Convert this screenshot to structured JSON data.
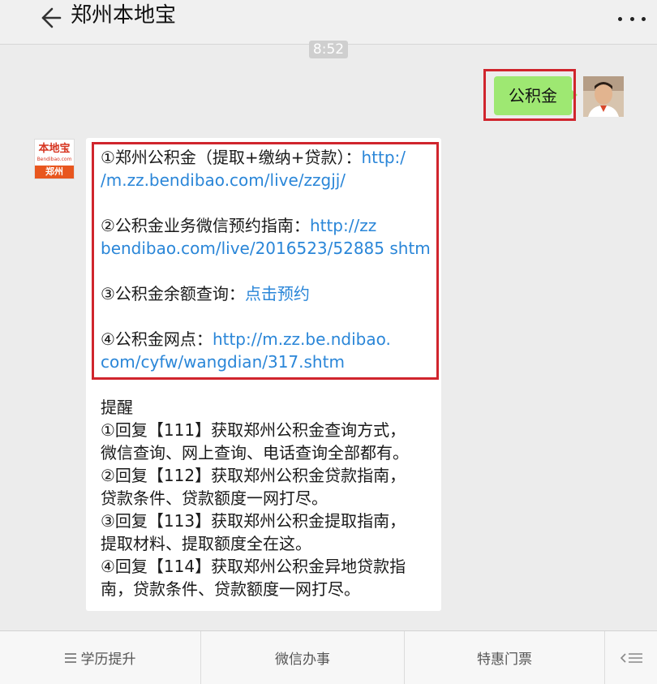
{
  "header": {
    "title": "郑州本地宝",
    "back_icon": "arrow-left-icon",
    "more_icon": "more-dots-icon"
  },
  "time_badge": "8:52",
  "sent_message": {
    "text": "公积金"
  },
  "bot": {
    "logo_text": "本地宝",
    "logo_sub": "Bendibao.com",
    "logo_city": "郑州"
  },
  "reply": {
    "item1_label": "①郑州公积金（提取+缴纳+贷款）：",
    "item1_link_a": "http:/",
    "item1_link_b": "/m.zz.bendibao.com/live/zzgjj/",
    "item2_label": "②公积金业务微信预约指南：",
    "item2_link_a": "http://zz",
    "item2_link_b": "bendibao.com/live/2016523/52885 shtm",
    "item3_label": "③公积金余额查询：",
    "item3_link": "点击预约",
    "item4_label": "④公积金网点：",
    "item4_link_a": "http://m.zz.be.ndibao.",
    "item4_link_b": "com/cyfw/wangdian/317.shtm",
    "reminder_title": "提醒",
    "reminder_lines": [
      "①回复【111】获取郑州公积金查询方式，",
      "微信查询、网上查询、电话查询全部都有。",
      "②回复【112】获取郑州公积金贷款指南，",
      "贷款条件、贷款额度一网打尽。",
      "③回复【113】获取郑州公积金提取指南，",
      "提取材料、提取额度全在这。",
      "④回复【114】获取郑州公积金异地贷款指",
      "南，贷款条件、贷款额度一网打尽。"
    ]
  },
  "bottom_menu": {
    "items": [
      "学历提升",
      "微信办事",
      "特惠门票"
    ],
    "menu_icon": "hamburger-icon",
    "keyboard_toggle_icon": "keyboard-toggle-icon"
  },
  "colors": {
    "sent_bubble": "#9ee872",
    "link": "#2a86d8",
    "highlight_border": "#d0252d",
    "background": "#ececec"
  }
}
